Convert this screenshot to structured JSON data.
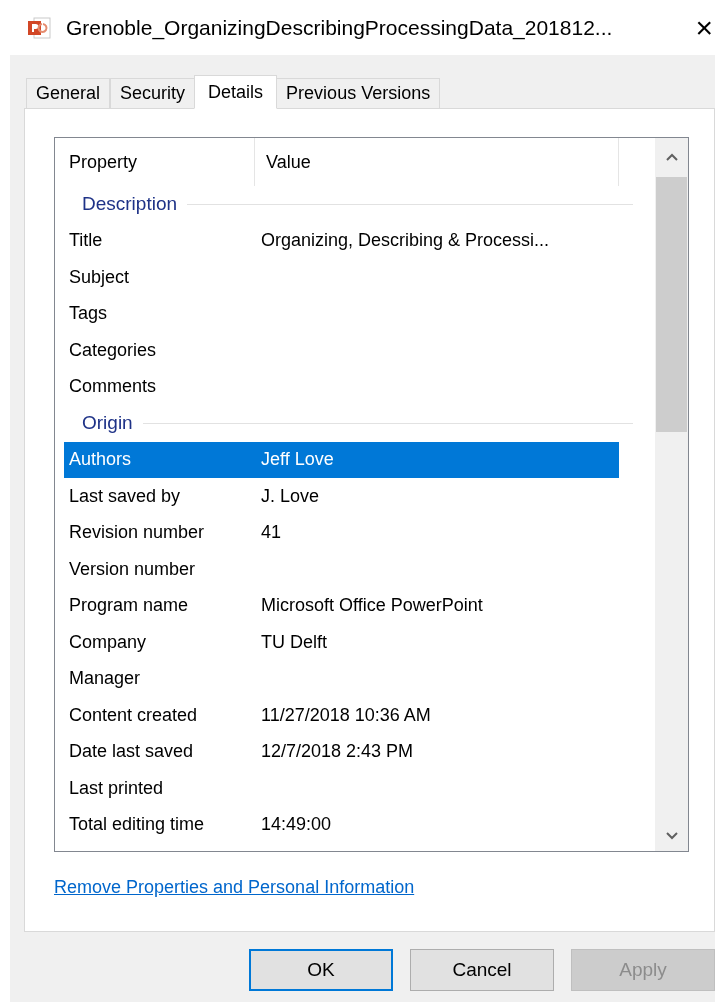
{
  "window": {
    "title": "Grenoble_OrganizingDescribingProcessingData_201812...",
    "close": "×"
  },
  "tabs": [
    {
      "label": "General",
      "selected": false
    },
    {
      "label": "Security",
      "selected": false
    },
    {
      "label": "Details",
      "selected": true
    },
    {
      "label": "Previous Versions",
      "selected": false
    }
  ],
  "table": {
    "columns": [
      "Property",
      "Value"
    ],
    "rows": [
      {
        "kind": "group",
        "label": "Description"
      },
      {
        "kind": "property",
        "property": "Title",
        "value": "Organizing, Describing & Processi...",
        "selected": false
      },
      {
        "kind": "property",
        "property": "Subject",
        "selected": false
      },
      {
        "kind": "property",
        "property": "Tags",
        "selected": false
      },
      {
        "kind": "property",
        "property": "Categories",
        "selected": false
      },
      {
        "kind": "property",
        "property": "Comments",
        "selected": false
      },
      {
        "kind": "group",
        "label": "Origin"
      },
      {
        "kind": "property",
        "property": "Authors",
        "value": "Jeff Love",
        "selected": true
      },
      {
        "kind": "property",
        "property": "Last saved by",
        "value": "J. Love",
        "selected": false
      },
      {
        "kind": "property",
        "property": "Revision number",
        "value": "41",
        "selected": false
      },
      {
        "kind": "property",
        "property": "Version number",
        "selected": false
      },
      {
        "kind": "property",
        "property": "Program name",
        "value": "Microsoft Office PowerPoint",
        "selected": false
      },
      {
        "kind": "property",
        "property": "Company",
        "value": "TU Delft",
        "selected": false
      },
      {
        "kind": "property",
        "property": "Manager",
        "selected": false
      },
      {
        "kind": "property",
        "property": "Content created",
        "value": "11/27/2018 10:36 AM",
        "selected": false
      },
      {
        "kind": "property",
        "property": "Date last saved",
        "value": "12/7/2018 2:43 PM",
        "selected": false
      },
      {
        "kind": "property",
        "property": "Last printed",
        "selected": false
      },
      {
        "kind": "property",
        "property": "Total editing time",
        "value": "14:49:00",
        "selected": false
      }
    ]
  },
  "link": "Remove Properties and Personal Information",
  "buttons": [
    {
      "label": "OK",
      "default": true,
      "disabled": false
    },
    {
      "label": "Cancel",
      "default": false,
      "disabled": false
    },
    {
      "label": "Apply",
      "default": false,
      "disabled": true
    }
  ]
}
